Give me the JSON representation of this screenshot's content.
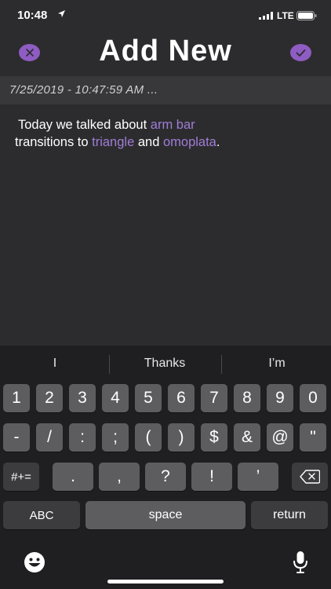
{
  "status": {
    "time": "10:48",
    "network": "LTE"
  },
  "nav": {
    "title": "Add New",
    "cancel_icon": "x-icon",
    "done_icon": "checkmark-icon"
  },
  "date": "7/25/2019 - 10:47:59 AM ...",
  "note": {
    "part1": "Today we talked about ",
    "hl1": "arm bar",
    "part2": " transitions to ",
    "hl2": "triangle",
    "part3": " and ",
    "hl3": "omoplata",
    "part4": "."
  },
  "colors": {
    "accent": "#8e5cc2",
    "highlight": "#a07cd6",
    "background": "#2c2c2e",
    "date_bar": "#38383a"
  },
  "keyboard": {
    "suggestions": [
      "I",
      "Thanks",
      "I’m"
    ],
    "row1": [
      "1",
      "2",
      "3",
      "4",
      "5",
      "6",
      "7",
      "8",
      "9",
      "0"
    ],
    "row2": [
      "-",
      "/",
      ":",
      ";",
      "(",
      ")",
      "$",
      "&",
      "@",
      "\""
    ],
    "row3": {
      "mode": "#+=",
      "keys": [
        ".",
        ",",
        "?",
        "!",
        "’"
      ]
    },
    "row4": {
      "abc": "ABC",
      "space": "space",
      "return": "return"
    },
    "emoji_icon": "emoji-icon",
    "mic_icon": "microphone-icon"
  }
}
